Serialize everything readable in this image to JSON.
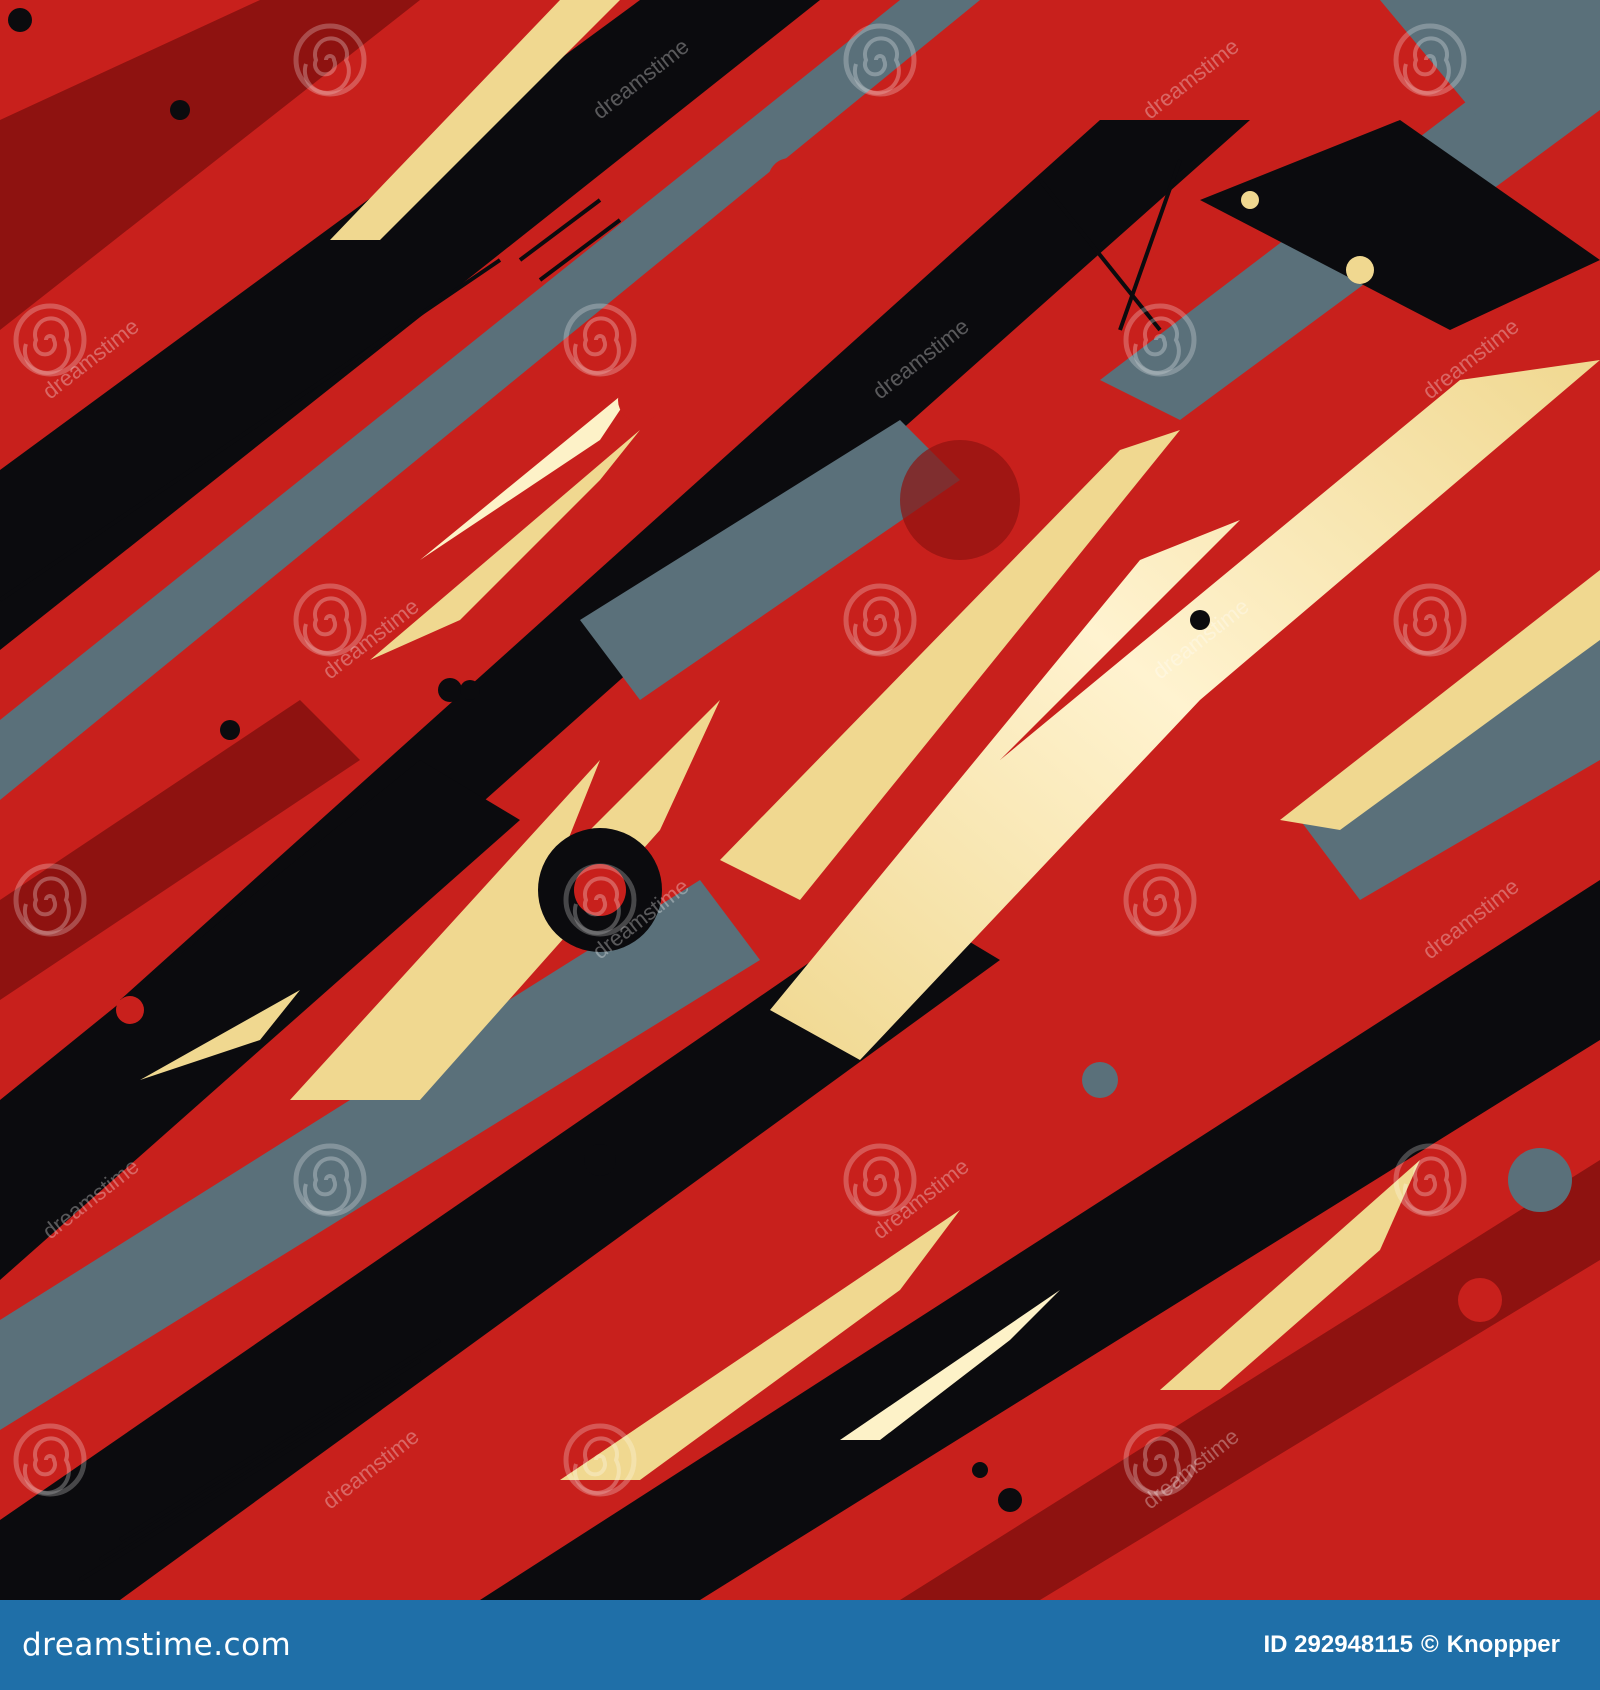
{
  "watermark": {
    "text": "dreamstime",
    "logo": "spiral-watermark-icon"
  },
  "footer": {
    "site": "dreamstime.com",
    "image_id": "ID 292948115",
    "copyright_symbol": "©",
    "author": "Knoppper"
  },
  "colors": {
    "red": "#c8201c",
    "dark_red": "#8e1210",
    "black": "#0b0b0e",
    "slate": "#5a707a",
    "cream": "#f0d890",
    "light_cream": "#fdf2c8",
    "footer_bg": "#1f6fa8"
  }
}
